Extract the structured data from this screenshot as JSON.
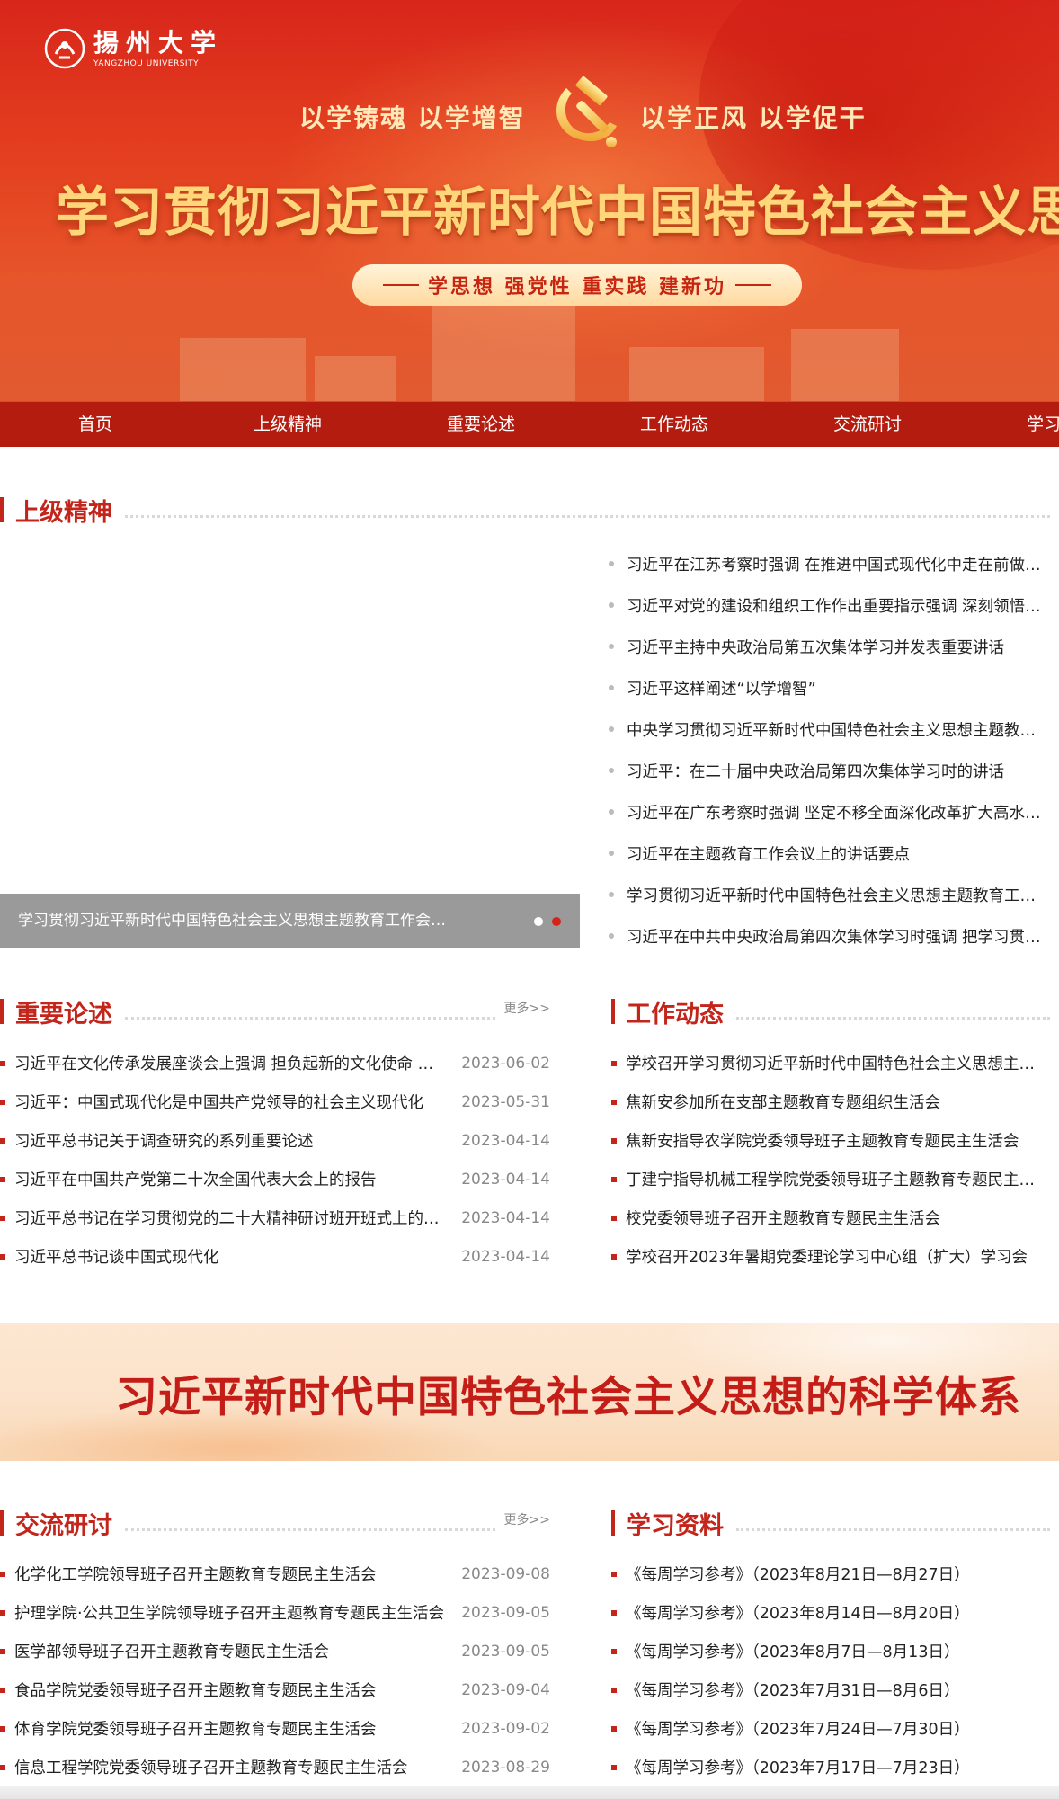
{
  "banner": {
    "logo_name": "揚州大学",
    "logo_en": "YANGZHOU UNIVERSITY",
    "slogan_left": "以学铸魂  以学增智",
    "slogan_right": "以学正风  以学促干",
    "main_title": "学习贯彻习近平新时代中国特色社会主义思想主题教育",
    "pill_text": "学思想  强党性  重实践  建新功",
    "colors": {
      "red": "#d8261b",
      "gold": "#ffd77a"
    }
  },
  "nav": {
    "items": [
      "首页",
      "上级精神",
      "重要论述",
      "工作动态",
      "交流研讨",
      "学习资料"
    ]
  },
  "higher_spirit": {
    "title": "上级精神",
    "carousel_caption": "学习贯彻习近平新时代中国特色社会主义思想主题教育工作会议在京召开",
    "items": [
      "习近平在江苏考察时强调 在推进中国式现代化中走在前做示范 谱写“强富美高”新江苏现代化建设新篇章",
      "习近平对党的建设和组织工作作出重要指示强调 深刻领悟党的建设的政治意义",
      "习近平主持中央政治局第五次集体学习并发表重要讲话",
      "习近平这样阐述“以学增智”",
      "中央学习贯彻习近平新时代中国特色社会主义思想主题教育领导小组印发通知",
      "习近平：在二十届中央政治局第四次集体学习时的讲话",
      "习近平在广东考察时强调 坚定不移全面深化改革扩大高水平对外开放",
      "习近平在主题教育工作会议上的讲话要点",
      "学习贯彻习近平新时代中国特色社会主义思想主题教育工作会议在京召开",
      "习近平在中共中央政治局第四次集体学习时强调 把学习贯彻党的二十大精神引向深入"
    ]
  },
  "important_remarks": {
    "title": "重要论述",
    "more": "更多>>",
    "items": [
      {
        "title": "习近平在文化传承发展座谈会上强调 担负起新的文化使命 努力建设中华民族现代文明",
        "date": "2023-06-02"
      },
      {
        "title": "习近平：中国式现代化是中国共产党领导的社会主义现代化",
        "date": "2023-05-31"
      },
      {
        "title": "习近平总书记关于调查研究的系列重要论述",
        "date": "2023-04-14"
      },
      {
        "title": "习近平在中国共产党第二十次全国代表大会上的报告",
        "date": "2023-04-14"
      },
      {
        "title": "习近平总书记在学习贯彻党的二十大精神研讨班开班式上的重要讲话",
        "date": "2023-04-14"
      },
      {
        "title": "习近平总书记谈中国式现代化",
        "date": "2023-04-14"
      }
    ]
  },
  "work_news": {
    "title": "工作动态",
    "items": [
      "学校召开学习贯彻习近平新时代中国特色社会主义思想主题教育总结会议",
      "焦新安参加所在支部主题教育专题组织生活会",
      "焦新安指导农学院党委领导班子主题教育专题民主生活会",
      "丁建宁指导机械工程学院党委领导班子主题教育专题民主生活会",
      "校党委领导班子召开主题教育专题民主生活会",
      "学校召开2023年暑期党委理论学习中心组（扩大）学习会"
    ]
  },
  "mid_banner": {
    "text": "习近平新时代中国特色社会主义思想的科学体系"
  },
  "exchange": {
    "title": "交流研讨",
    "more": "更多>>",
    "items": [
      {
        "title": "化学化工学院领导班子召开主题教育专题民主生活会",
        "date": "2023-09-08"
      },
      {
        "title": "护理学院·公共卫生学院领导班子召开主题教育专题民主生活会",
        "date": "2023-09-05"
      },
      {
        "title": "医学部领导班子召开主题教育专题民主生活会",
        "date": "2023-09-05"
      },
      {
        "title": "食品学院党委领导班子召开主题教育专题民主生活会",
        "date": "2023-09-04"
      },
      {
        "title": "体育学院党委领导班子召开主题教育专题民主生活会",
        "date": "2023-09-02"
      },
      {
        "title": "信息工程学院党委领导班子召开主题教育专题民主生活会",
        "date": "2023-08-29"
      }
    ]
  },
  "study_materials": {
    "title": "学习资料",
    "items": [
      "《每周学习参考》（2023年8月21日—8月27日）",
      "《每周学习参考》（2023年8月14日—8月20日）",
      "《每周学习参考》（2023年8月7日—8月13日）",
      "《每周学习参考》（2023年7月31日—8月6日）",
      "《每周学习参考》（2023年7月24日—7月30日）",
      "《每周学习参考》（2023年7月17日—7月23日）"
    ]
  }
}
